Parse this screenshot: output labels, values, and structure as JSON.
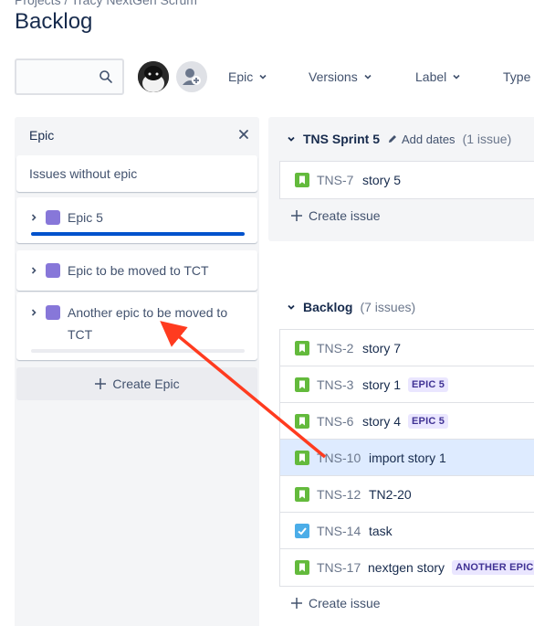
{
  "breadcrumb": "Projects / Tracy NextGen Scrum",
  "page_title": "Backlog",
  "toolbar": {
    "search_placeholder": "",
    "filters": [
      {
        "label": "Epic"
      },
      {
        "label": "Versions"
      },
      {
        "label": "Label"
      },
      {
        "label": "Type"
      }
    ]
  },
  "epic_panel": {
    "title": "Epic",
    "issues_without_epic": "Issues without epic",
    "epics": [
      {
        "name": "Epic 5",
        "progress": 1.0,
        "color": "#8777d9"
      },
      {
        "name": "Epic to be moved to TCT",
        "progress": null,
        "color": "#8777d9"
      },
      {
        "name_line1": "Another epic to be moved to",
        "name_line2": "TCT",
        "progress": 0.0,
        "color": "#8777d9"
      }
    ],
    "create_label": "Create Epic"
  },
  "sprint": {
    "title": "TNS Sprint 5",
    "add_dates": "Add dates",
    "count": "(1 issue)",
    "issues": [
      {
        "key": "TNS-7",
        "summary": "story 5",
        "type": "story"
      }
    ],
    "create_issue": "Create issue"
  },
  "backlog": {
    "title": "Backlog",
    "count": "(7 issues)",
    "issues": [
      {
        "key": "TNS-2",
        "summary": "story 7",
        "type": "story",
        "epic": ""
      },
      {
        "key": "TNS-3",
        "summary": "story 1",
        "type": "story",
        "epic": "EPIC 5"
      },
      {
        "key": "TNS-6",
        "summary": "story 4",
        "type": "story",
        "epic": "EPIC 5"
      },
      {
        "key": "TNS-10",
        "summary": "import story 1",
        "type": "story",
        "epic": "",
        "selected": true
      },
      {
        "key": "TNS-12",
        "summary": "TN2-20",
        "type": "story",
        "epic": ""
      },
      {
        "key": "TNS-14",
        "summary": "task",
        "type": "task",
        "epic": ""
      },
      {
        "key": "TNS-17",
        "summary": "nextgen story",
        "type": "story",
        "epic": "ANOTHER EPIC"
      }
    ],
    "create_issue": "Create issue"
  },
  "colors": {
    "story": "#63ba3c",
    "task": "#4bade8",
    "epic_lozenge_bg": "#eae6ff",
    "epic_lozenge_text": "#403294",
    "selected_row": "#deebff",
    "annotation_arrow": "#ff3b1f"
  }
}
